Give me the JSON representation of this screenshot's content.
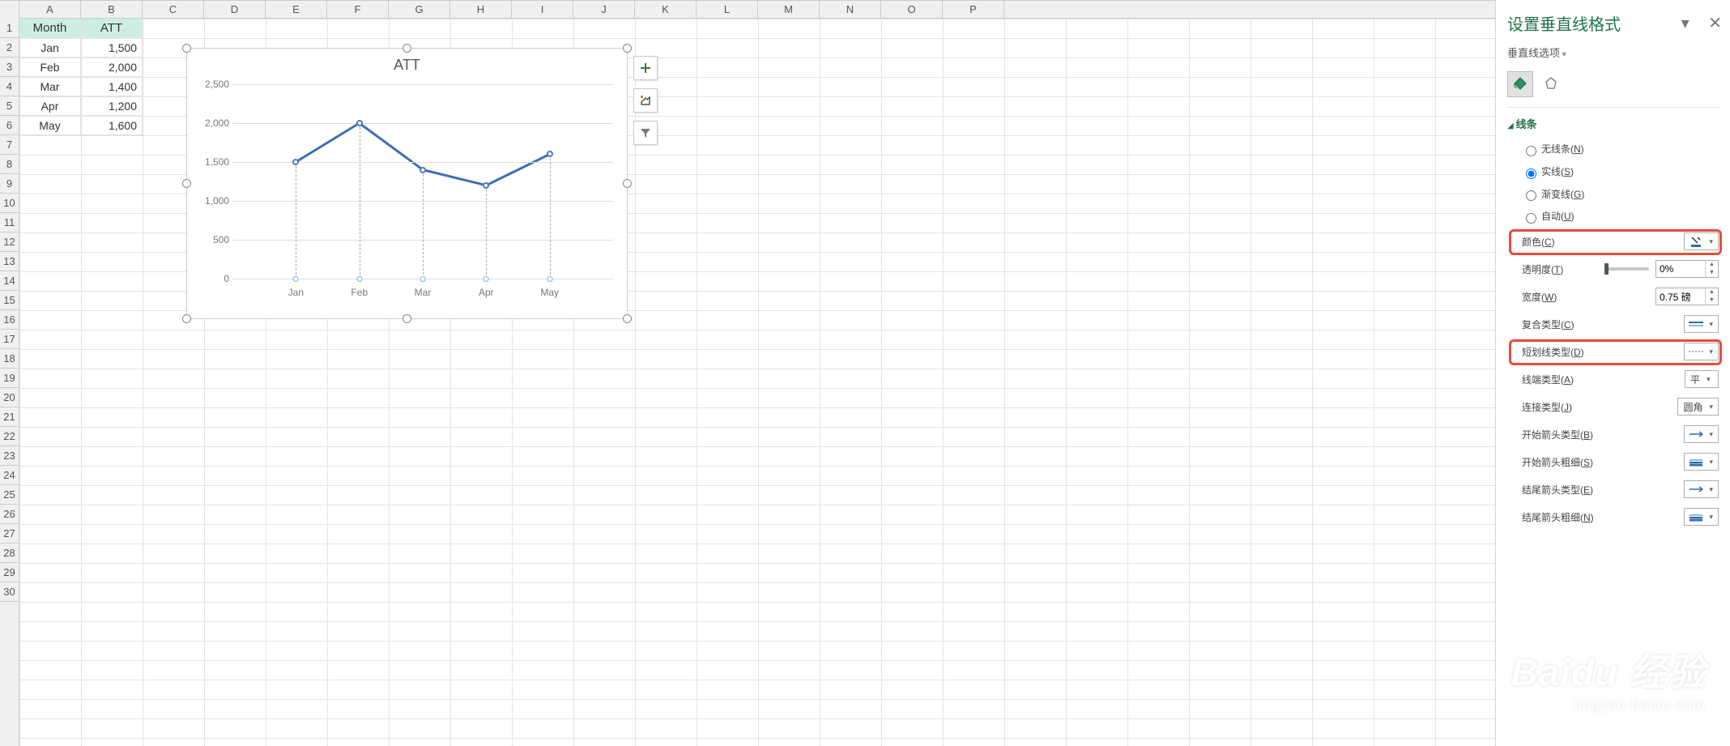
{
  "columns": [
    "A",
    "B",
    "C",
    "D",
    "E",
    "F",
    "G",
    "H",
    "I",
    "J",
    "K",
    "L",
    "M",
    "N",
    "O",
    "P"
  ],
  "row_count": 30,
  "table": {
    "headers": [
      "Month",
      "ATT"
    ],
    "rows": [
      {
        "month": "Jan",
        "att": "1,500"
      },
      {
        "month": "Feb",
        "att": "2,000"
      },
      {
        "month": "Mar",
        "att": "1,400"
      },
      {
        "month": "Apr",
        "att": "1,200"
      },
      {
        "month": "May",
        "att": "1,600"
      }
    ]
  },
  "chart_data": {
    "type": "line",
    "title": "ATT",
    "categories": [
      "Jan",
      "Feb",
      "Mar",
      "Apr",
      "May"
    ],
    "values": [
      1500,
      2000,
      1400,
      1200,
      1600
    ],
    "yticks": [
      0,
      500,
      1000,
      1500,
      2000,
      2500
    ],
    "ylim": [
      0,
      2500
    ],
    "xlabel": "",
    "ylabel": ""
  },
  "chart_buttons": {
    "plus": "+",
    "brush": "brush",
    "filter": "filter"
  },
  "format_pane": {
    "title": "设置垂直线格式",
    "options_label": "垂直线选项",
    "section_line": "线条",
    "radios": {
      "none": "无线条(N)",
      "solid": "实线(S)",
      "gradient": "渐变线(G)",
      "auto": "自动(U)",
      "selected": "solid"
    },
    "props": {
      "color": "颜色(C)",
      "transparency": "透明度(T)",
      "transparency_val": "0%",
      "width": "宽度(W)",
      "width_val": "0.75 磅",
      "compound": "复合类型(C)",
      "dash": "短划线类型(D)",
      "cap": "线端类型(A)",
      "cap_val": "平",
      "join": "连接类型(J)",
      "join_val": "圆角",
      "begin_arrow_type": "开始箭头类型(B)",
      "begin_arrow_size": "开始箭头粗细(S)",
      "end_arrow_type": "结尾箭头类型(E)",
      "end_arrow_size": "结尾箭头粗细(N)"
    }
  },
  "watermark": {
    "big": "Baidu 经验",
    "small": "jingyan.baidu.com"
  }
}
